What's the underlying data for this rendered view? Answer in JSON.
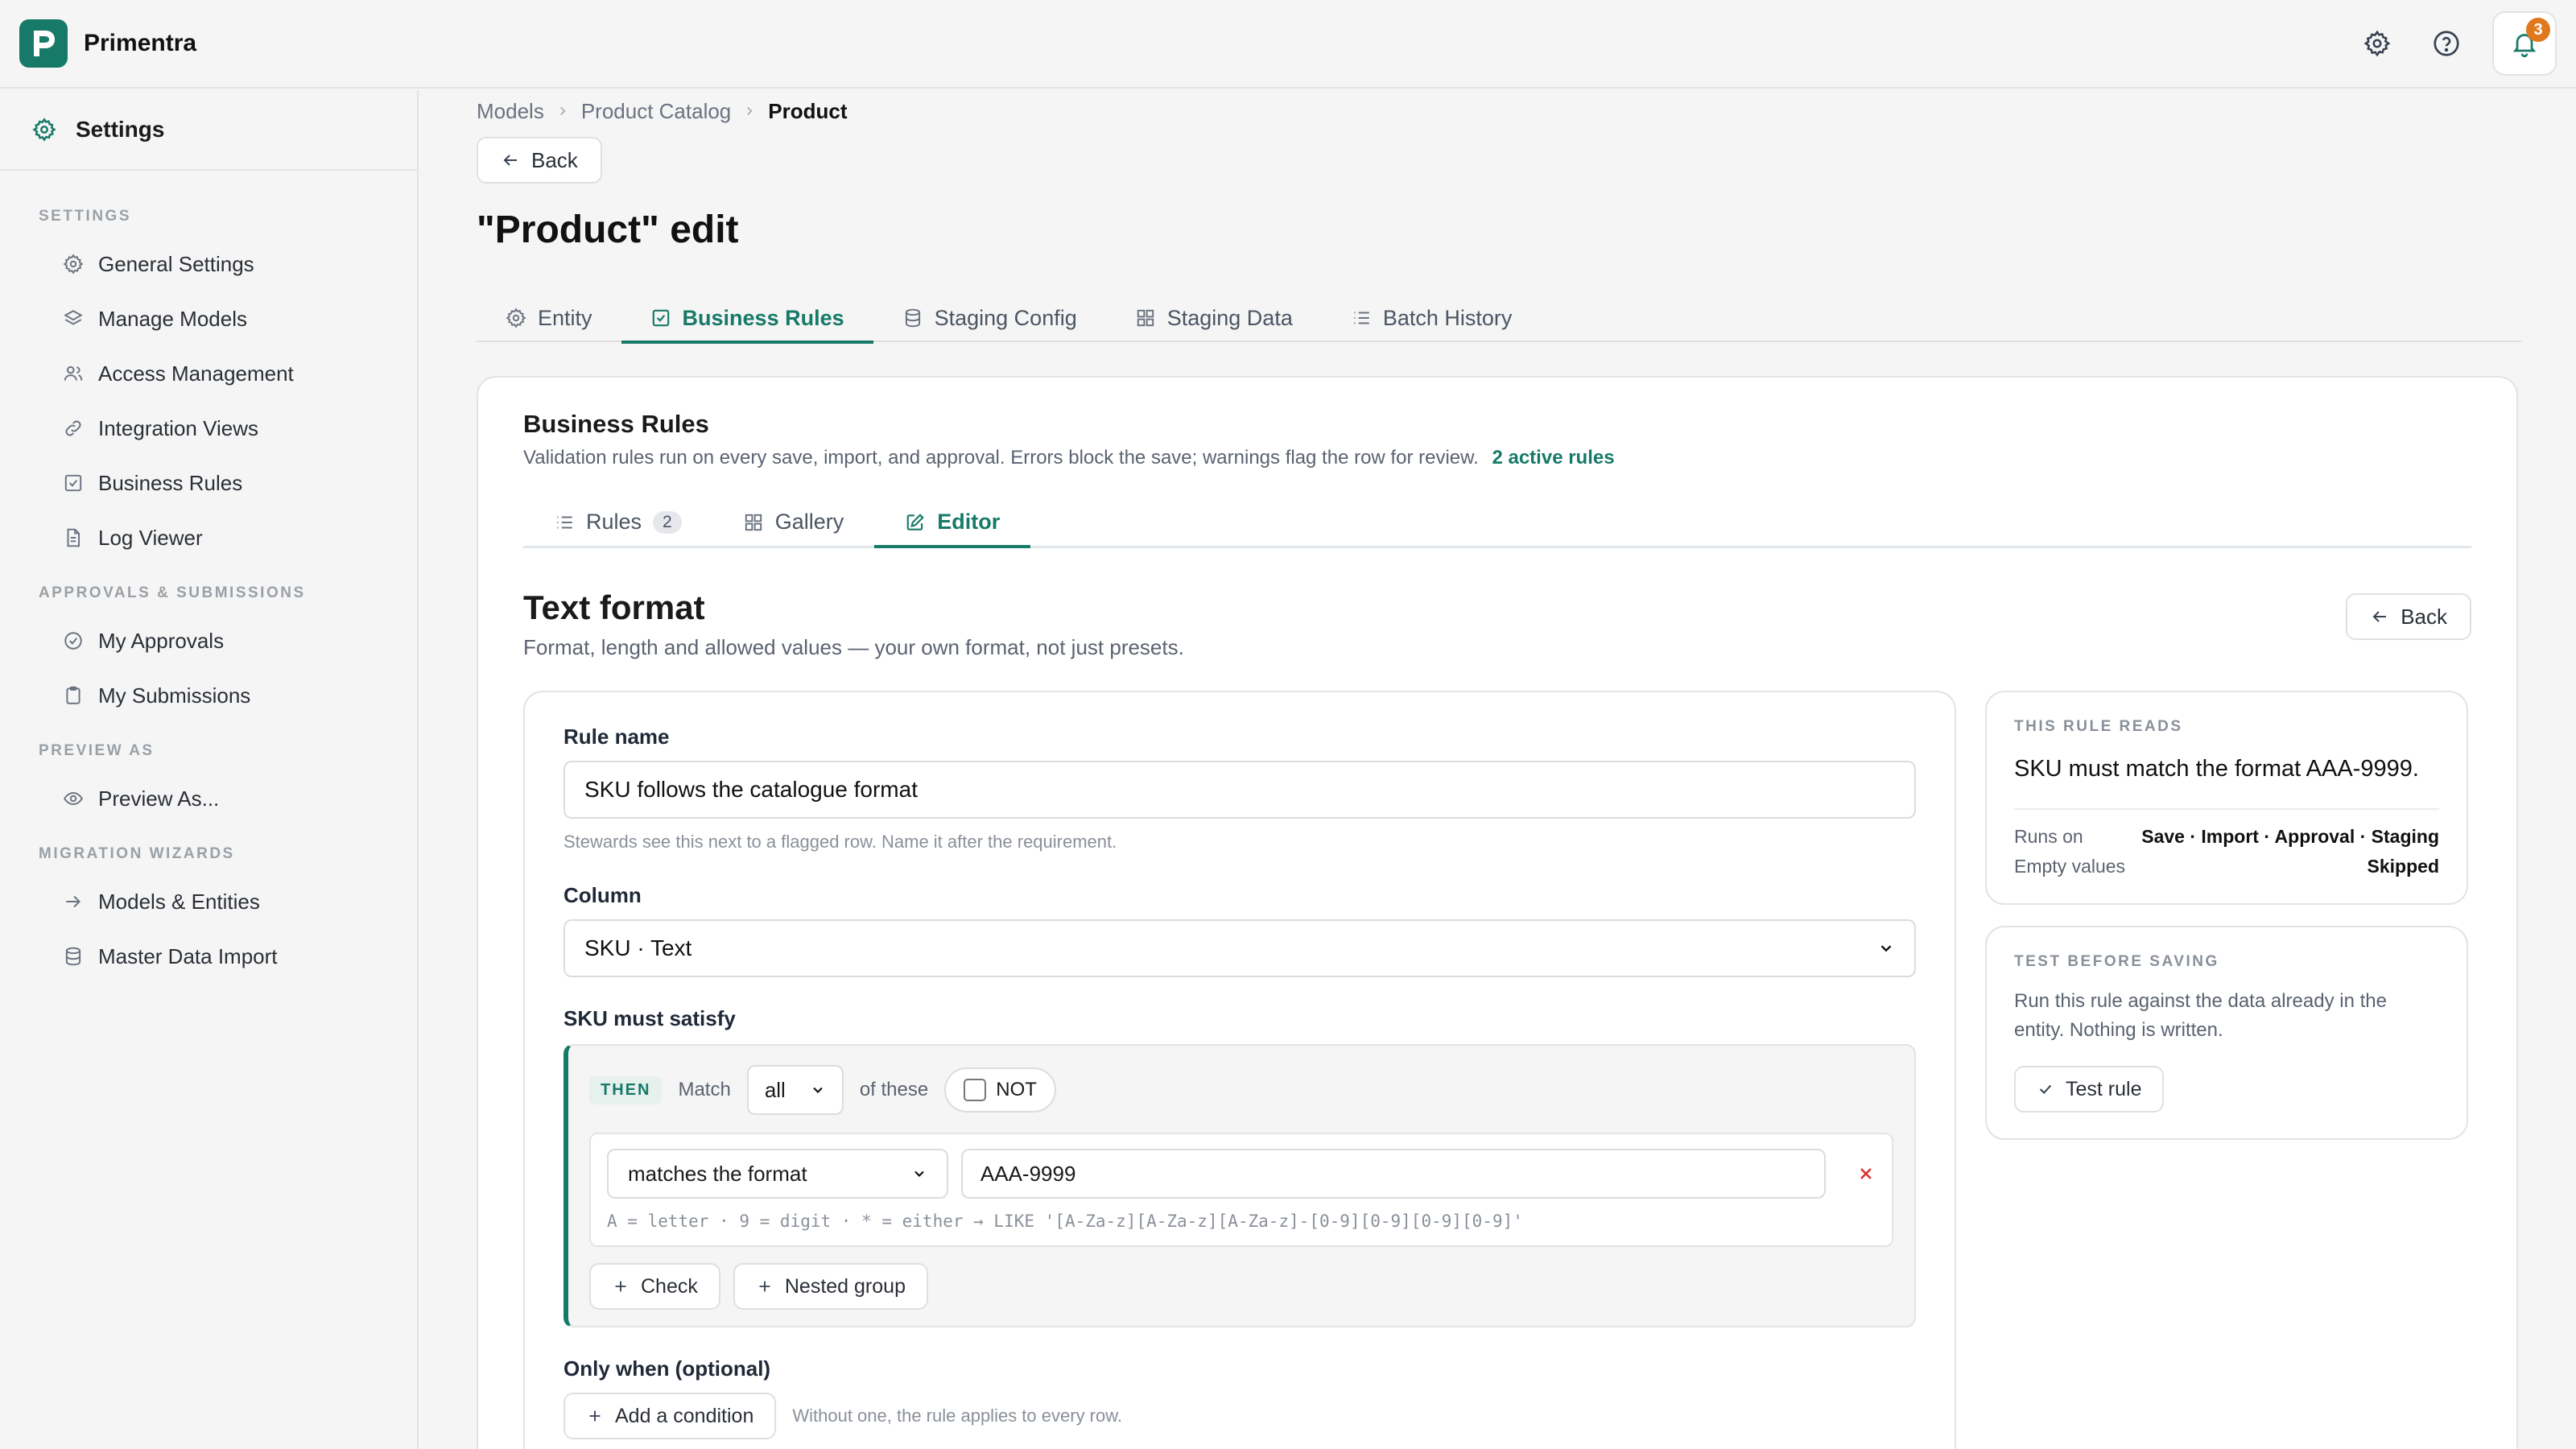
{
  "app": {
    "brand": "Primentra",
    "logo_letter": "P",
    "accent": "#177a68",
    "notifications_count": "3"
  },
  "sidebar": {
    "header": "Settings",
    "groups": [
      {
        "label": "SETTINGS",
        "items": [
          {
            "label": "General Settings",
            "icon": "gear-icon"
          },
          {
            "label": "Manage Models",
            "icon": "layers-icon"
          },
          {
            "label": "Access Management",
            "icon": "users-icon"
          },
          {
            "label": "Integration Views",
            "icon": "link-icon"
          },
          {
            "label": "Business Rules",
            "icon": "checkbox-icon"
          },
          {
            "label": "Log Viewer",
            "icon": "document-icon"
          }
        ]
      },
      {
        "label": "APPROVALS & SUBMISSIONS",
        "items": [
          {
            "label": "My Approvals",
            "icon": "check-circle-icon"
          },
          {
            "label": "My Submissions",
            "icon": "clipboard-icon"
          }
        ]
      },
      {
        "label": "PREVIEW AS",
        "items": [
          {
            "label": "Preview As...",
            "icon": "eye-icon"
          }
        ]
      },
      {
        "label": "MIGRATION WIZARDS",
        "items": [
          {
            "label": "Models & Entities",
            "icon": "arrow-right-icon"
          },
          {
            "label": "Master Data Import",
            "icon": "database-icon"
          }
        ]
      }
    ]
  },
  "breadcrumb": [
    "Models",
    "Product Catalog",
    "Product"
  ],
  "back_label": "Back",
  "page_title": "\"Product\" edit",
  "tabs": [
    {
      "label": "Entity",
      "icon": "gear-icon"
    },
    {
      "label": "Business Rules",
      "icon": "checkbox-icon"
    },
    {
      "label": "Staging Config",
      "icon": "database-icon"
    },
    {
      "label": "Staging Data",
      "icon": "grid-icon"
    },
    {
      "label": "Batch History",
      "icon": "list-icon"
    }
  ],
  "business_rules": {
    "title": "Business Rules",
    "description": "Validation rules run on every save, import, and approval. Errors block the save; warnings flag the row for review.",
    "active_rules": "2 active rules",
    "subtabs": [
      {
        "label": "Rules",
        "count": "2"
      },
      {
        "label": "Gallery"
      },
      {
        "label": "Editor"
      }
    ]
  },
  "editor": {
    "title": "Text format",
    "subtitle": "Format, length and allowed values — your own format, not just presets.",
    "back_label": "Back",
    "rule_name_label": "Rule name",
    "rule_name_value": "SKU follows the catalogue format",
    "rule_name_hint": "Stewards see this next to a flagged row. Name it after the requirement.",
    "column_label": "Column",
    "column_value": "SKU · Text",
    "satisfy_label": "SKU must satisfy",
    "then_label": "THEN",
    "match_label": "Match",
    "match_value": "all",
    "of_these": "of these",
    "not_label": "NOT",
    "operator_value": "matches the format",
    "pattern_value": "AAA-9999",
    "legend": "A = letter · 9 = digit · * = either  →  LIKE '[A-Za-z][A-Za-z][A-Za-z]-[0-9][0-9][0-9][0-9]'",
    "add_check": "Check",
    "add_group": "Nested group",
    "only_when_label": "Only when (optional)",
    "add_condition": "Add a condition",
    "only_when_hint": "Without one, the rule applies to every row."
  },
  "rule_reads": {
    "label": "THIS RULE READS",
    "text": "SKU must match the format AAA-9999.",
    "runs_on_key": "Runs on",
    "runs_on_value": "Save · Import · Approval · Staging",
    "empty_key": "Empty values",
    "empty_value": "Skipped"
  },
  "test_panel": {
    "label": "TEST BEFORE SAVING",
    "text": "Run this rule against the data already in the entity. Nothing is written.",
    "button": "Test rule"
  }
}
